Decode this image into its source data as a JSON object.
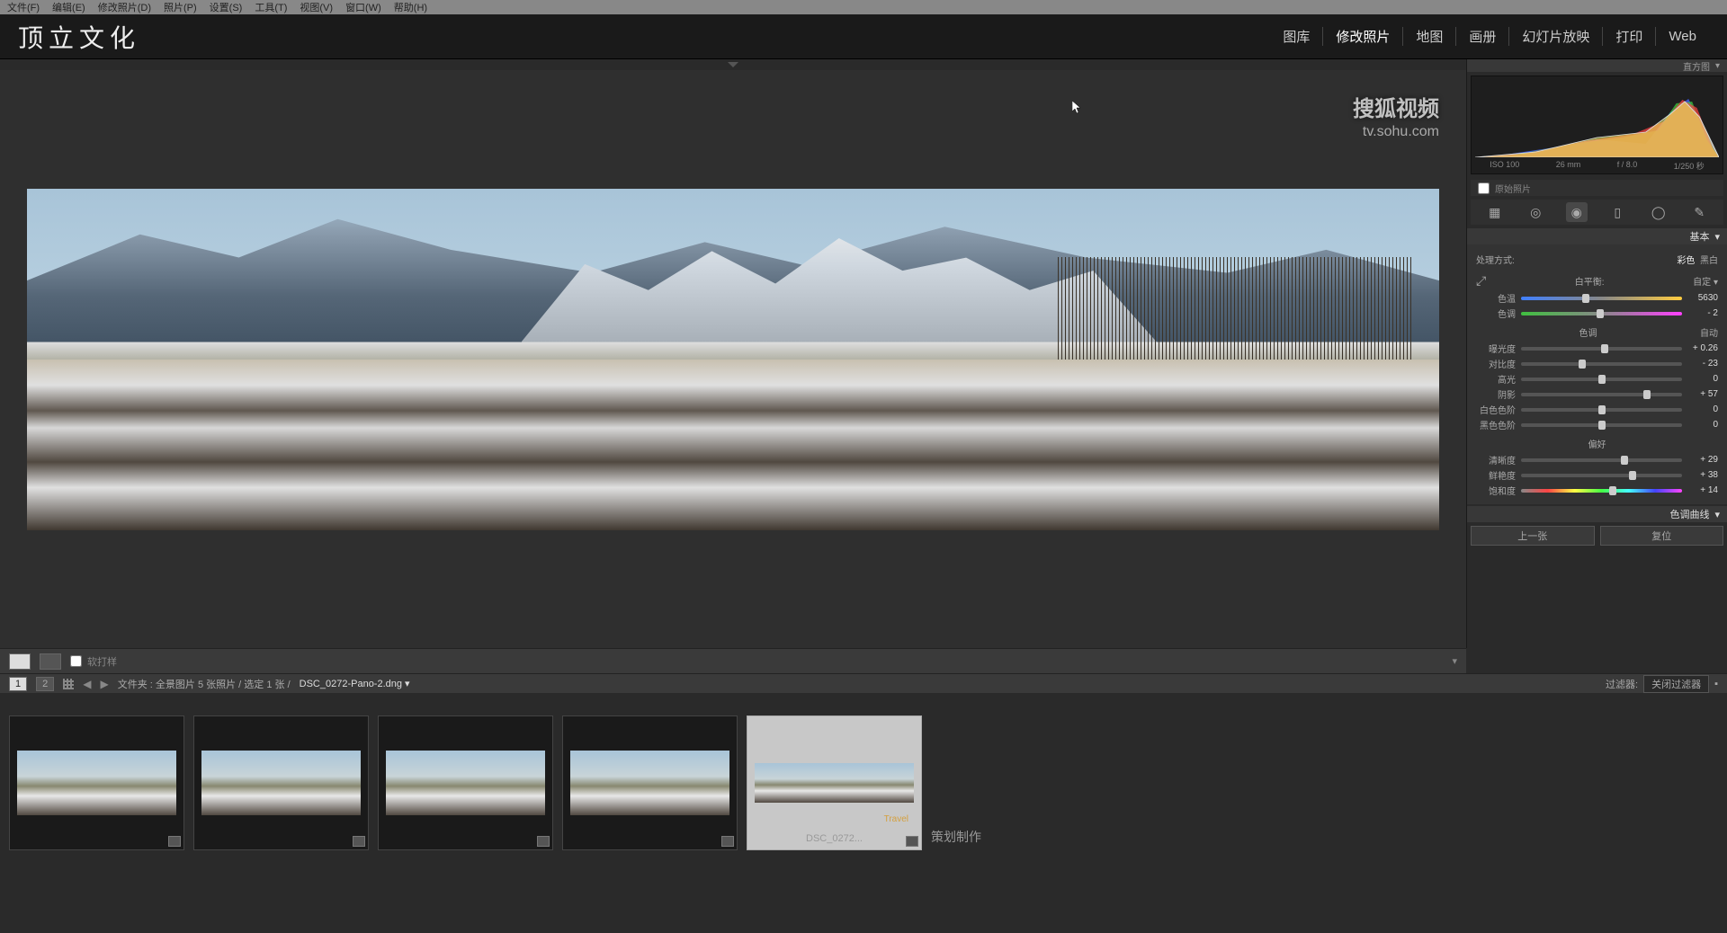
{
  "menu": {
    "file": "文件(F)",
    "edit": "编辑(E)",
    "develop": "修改照片(D)",
    "photo": "照片(P)",
    "settings": "设置(S)",
    "tools": "工具(T)",
    "view": "视图(V)",
    "window": "窗口(W)",
    "help": "帮助(H)"
  },
  "logo": "顶立文化",
  "modules": {
    "library": "图库",
    "develop": "修改照片",
    "map": "地图",
    "book": "画册",
    "slideshow": "幻灯片放映",
    "print": "打印",
    "web": "Web"
  },
  "watermark": {
    "main": "搜狐视频",
    "sub": "tv.sohu.com"
  },
  "panel": {
    "histogram_title": "直方图",
    "meta": {
      "iso": "ISO 100",
      "focal": "26 mm",
      "aperture": "f / 8.0",
      "shutter": "1/250 秒"
    },
    "original": "原始照片",
    "basic_header": "基本",
    "process": {
      "label": "处理方式:",
      "color": "彩色",
      "bw": "黑白"
    },
    "wb": {
      "label": "白平衡:",
      "mode": "自定"
    },
    "temp": {
      "label": "色温",
      "value": "5630"
    },
    "tint": {
      "label": "色调",
      "value": "- 2"
    },
    "tone_hdr": "色调",
    "auto": "自动",
    "exposure": {
      "label": "曝光度",
      "value": "+ 0.26"
    },
    "contrast": {
      "label": "对比度",
      "value": "- 23"
    },
    "highlights": {
      "label": "高光",
      "value": "0"
    },
    "shadows": {
      "label": "阴影",
      "value": "+ 57"
    },
    "whites": {
      "label": "白色色阶",
      "value": "0"
    },
    "blacks": {
      "label": "黑色色阶",
      "value": "0"
    },
    "presence_hdr": "偏好",
    "clarity": {
      "label": "清晰度",
      "value": "+ 29"
    },
    "vibrance": {
      "label": "鲜艳度",
      "value": "+ 38"
    },
    "saturation": {
      "label": "饱和度",
      "value": "+ 14"
    },
    "tone_curve": "色调曲线",
    "prev_btn": "上一张",
    "reset_btn": "复位"
  },
  "toolbar": {
    "soft_proof": "软打样"
  },
  "infobar": {
    "num1": "1",
    "num2": "2",
    "breadcrumb": "文件夹 : 全景图片   5 张照片 / 选定 1 张 /",
    "filename": "DSC_0272-Pano-2.dng",
    "filter_label": "过滤器:",
    "filter_value": "关闭过滤器"
  },
  "filmstrip": {
    "selected_caption": "DSC_0272...",
    "credit": "策划制作",
    "travel": "Travel"
  }
}
